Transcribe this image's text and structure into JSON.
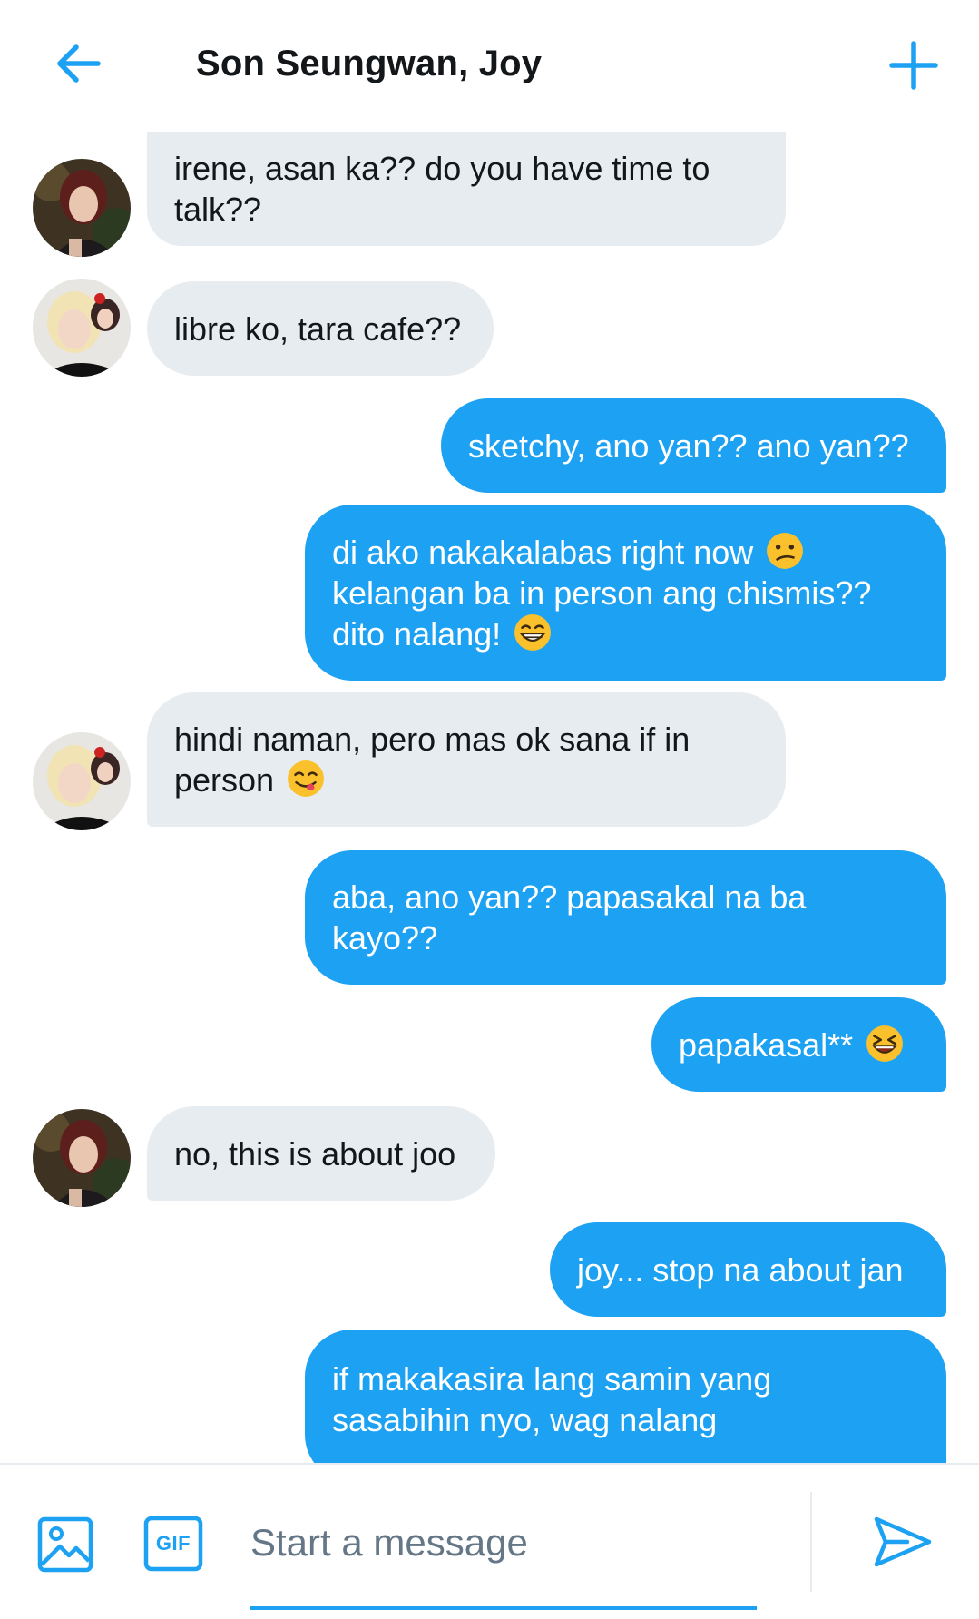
{
  "header": {
    "title": "Son Seungwan, Joy",
    "back_icon": "arrow-left-icon",
    "add_icon": "plus-icon",
    "accent_color": "#1da1f2"
  },
  "messages": [
    {
      "direction": "incoming",
      "sender_avatar": "avatar-joy",
      "text": "irene, asan ka?? do you have time to talk??"
    },
    {
      "direction": "incoming",
      "sender_avatar": "avatar-seungwan",
      "text": "libre ko, tara cafe??"
    },
    {
      "direction": "outgoing",
      "text": "sketchy, ano yan?? ano yan??"
    },
    {
      "direction": "outgoing",
      "text_line1": "di ako nakakalabas right now",
      "text_line2": "kelangan ba in person ang chismis??",
      "text_line3": "dito nalang!",
      "emojis": [
        "confused-face-emoji",
        "grinning-face-emoji"
      ]
    },
    {
      "direction": "incoming",
      "sender_avatar": "avatar-seungwan",
      "text_line1": "hindi naman, pero mas ok sana if in",
      "text_line2": "person",
      "emojis": [
        "savoring-food-face-emoji"
      ]
    },
    {
      "direction": "outgoing",
      "text": "aba, ano yan?? papasakal na ba kayo??"
    },
    {
      "direction": "outgoing",
      "text": "papakasal**",
      "emojis": [
        "squinting-laughing-face-emoji"
      ]
    },
    {
      "direction": "incoming",
      "sender_avatar": "avatar-joy",
      "text": "no, this is about joo"
    },
    {
      "direction": "outgoing",
      "text": "joy... stop na about jan"
    },
    {
      "direction": "outgoing",
      "text": "if makakasira lang samin yang sasabihin nyo, wag nalang"
    }
  ],
  "composer": {
    "placeholder": "Start a message",
    "value": "",
    "media_icon": "image-icon",
    "gif_label": "GIF",
    "send_icon": "send-icon"
  },
  "colors": {
    "incoming_bubble": "#e6ecf0",
    "outgoing_bubble": "#1da1f2",
    "text_dark": "#14171a",
    "placeholder": "#657786"
  }
}
